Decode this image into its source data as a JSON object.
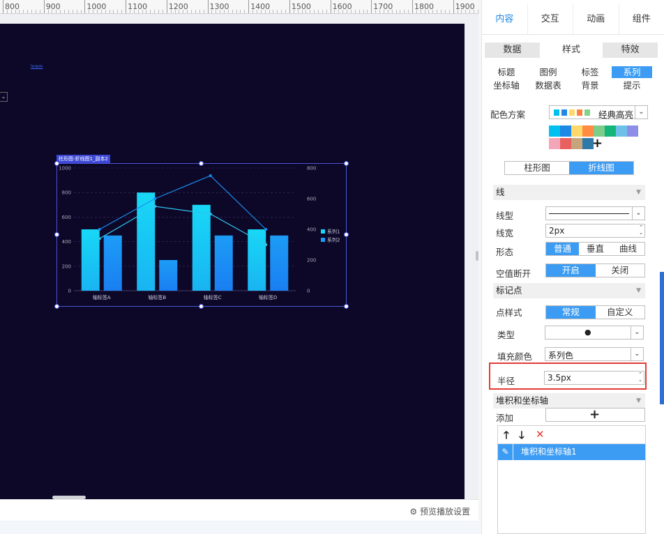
{
  "ruler": {
    "labels": [
      "800",
      "900",
      "1000",
      "1100",
      "1200",
      "1300",
      "1400",
      "1500",
      "1600",
      "1700",
      "1800",
      "1900"
    ]
  },
  "canvas": {
    "link_text": "lorem",
    "chart_tag": "柱形图-折线图1_副本2"
  },
  "chart_data": {
    "type": "bar",
    "categories": [
      "轴标签A",
      "轴标签B",
      "轴标签C",
      "轴标签D"
    ],
    "series": [
      {
        "name": "系列1",
        "type": "bar",
        "values": [
          500,
          800,
          700,
          500
        ],
        "color": "#18d8f6"
      },
      {
        "name": "系列2",
        "type": "bar",
        "values": [
          450,
          250,
          450,
          450
        ],
        "color": "#1c9cf6"
      },
      {
        "type": "line",
        "axis": "right",
        "values": [
          340,
          550,
          500,
          300
        ],
        "color": "#2fc4ee"
      },
      {
        "type": "line",
        "axis": "right",
        "values": [
          400,
          600,
          750,
          400
        ],
        "color": "#1b8cf0"
      }
    ],
    "ylim": [
      0,
      1000
    ],
    "yticks": [
      "0",
      "200",
      "400",
      "600",
      "800",
      "1000"
    ],
    "y2lim": [
      0,
      800
    ],
    "y2ticks": [
      "0",
      "200",
      "400",
      "600",
      "800"
    ],
    "grid": true,
    "legend": "right"
  },
  "bottom": {
    "preview_setting": "预览播放设置",
    "gear_icon": "gear-icon"
  },
  "panel": {
    "main_tabs": [
      "内容",
      "交互",
      "动画",
      "组件"
    ],
    "sub_tabs": [
      "数据",
      "样式",
      "特效"
    ],
    "categories": [
      "标题",
      "图例",
      "标签",
      "系列",
      "坐标轴",
      "数据表",
      "背景",
      "提示"
    ],
    "color_scheme": {
      "label": "配色方案",
      "name": "经典高亮",
      "swatches": [
        "#00c0f0",
        "#1e88e5",
        "#ffd86b",
        "#ff7f3f",
        "#7fd28a"
      ],
      "palette": [
        "#00c0f0",
        "#1e88e5",
        "#ffd86b",
        "#ff8c42",
        "#7ccd8a",
        "#16b67a",
        "#6dc1e8",
        "#8e8ee8",
        "#f4a6b8",
        "#e86060",
        "#c6a57c",
        "#2f79a8"
      ]
    },
    "chart_switch": [
      "柱形图",
      "折线图"
    ],
    "line_section": "线",
    "line_type_label": "线型",
    "line_width_label": "线宽",
    "line_width_value": "2px",
    "shape_label": "形态",
    "shape_options": [
      "普通",
      "垂直",
      "曲线"
    ],
    "gap_label": "空值断开",
    "gap_options": [
      "开启",
      "关闭"
    ],
    "marker_section": "标记点",
    "point_style_label": "点样式",
    "point_style_options": [
      "常规",
      "自定义"
    ],
    "type_label": "类型",
    "type_value": "●",
    "fill_label": "填充颜色",
    "fill_value": "系列色",
    "radius_label": "半径",
    "radius_value": "3.5px",
    "stack_section": "堆积和坐标轴",
    "add_label": "添加",
    "add_symbol": "+",
    "stack_item": "堆积和坐标轴1",
    "up_symbol": "🡑",
    "down_symbol": "🡓",
    "delete_symbol": "✕",
    "edit_symbol": "✎",
    "plus_symbol": "+"
  }
}
